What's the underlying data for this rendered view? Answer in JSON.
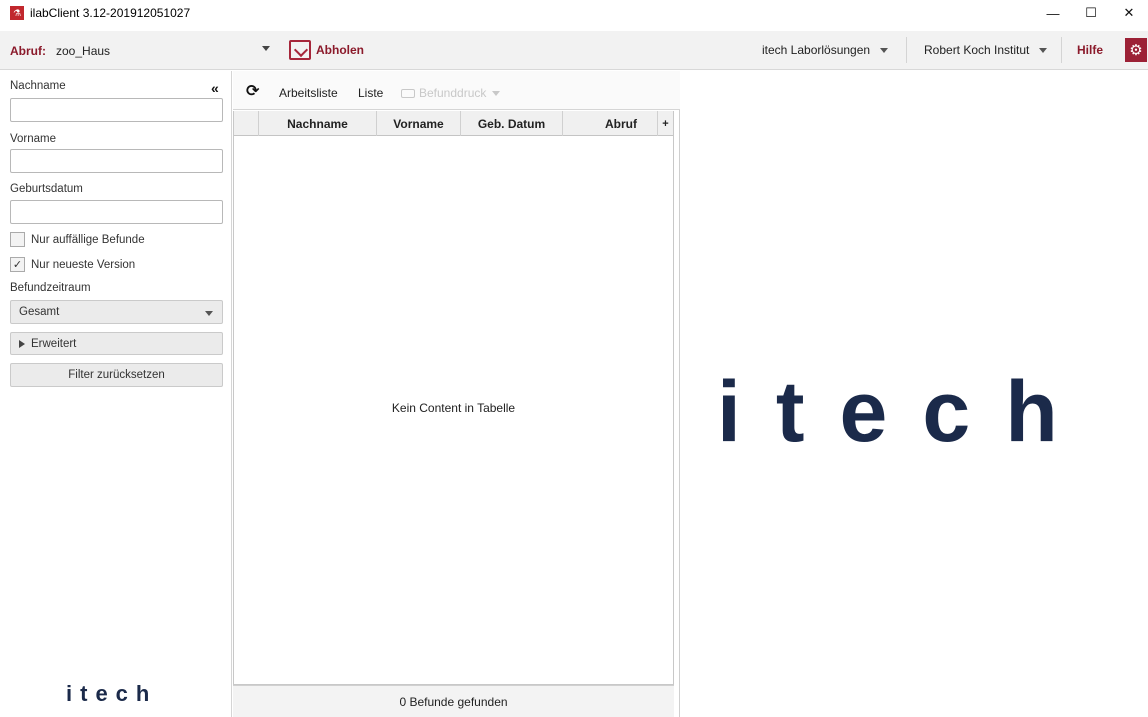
{
  "window": {
    "title": "ilabClient 3.12-201912051027",
    "minimize": "—",
    "maximize": "☐",
    "close": "✕"
  },
  "toolbar": {
    "abruf_label": "Abruf:",
    "abruf_value": "zoo_Haus",
    "abholen_label": "Abholen",
    "lab_dropdown": "itech Laborlösungen",
    "institute_dropdown": "Robert Koch Institut",
    "help_label": "Hilfe",
    "settings_icon": "gear-icon"
  },
  "sidebar": {
    "collapse_icon": "«",
    "nachname_label": "Nachname",
    "nachname_value": "",
    "vorname_label": "Vorname",
    "vorname_value": "",
    "geburtsdatum_label": "Geburtsdatum",
    "geburtsdatum_value": "",
    "checkbox_auffaellig": {
      "label": "Nur auffällige Befunde",
      "checked": false
    },
    "checkbox_neueste": {
      "label": "Nur neueste Version",
      "checked": true
    },
    "befundzeitraum_label": "Befundzeitraum",
    "befundzeitraum_value": "Gesamt",
    "erweitert_label": "Erweitert",
    "reset_label": "Filter zurücksetzen",
    "logo_text": "itech"
  },
  "center": {
    "refresh_icon": "refresh-icon",
    "arbeitsliste_label": "Arbeitsliste",
    "liste_label": "Liste",
    "befunddruck_label": "Befunddruck",
    "table": {
      "columns": [
        "",
        "Nachname",
        "Vorname",
        "Geb. Datum",
        "Abruf",
        "+"
      ],
      "rows": [],
      "empty_message": "Kein Content in Tabelle"
    },
    "footer": "0 Befunde gefunden"
  },
  "right_panel": {
    "logo_text": "itech"
  },
  "colors": {
    "brand_red": "#8b1a2b",
    "logo_navy": "#1b2a4a",
    "logo_dot": "#b0223a"
  }
}
